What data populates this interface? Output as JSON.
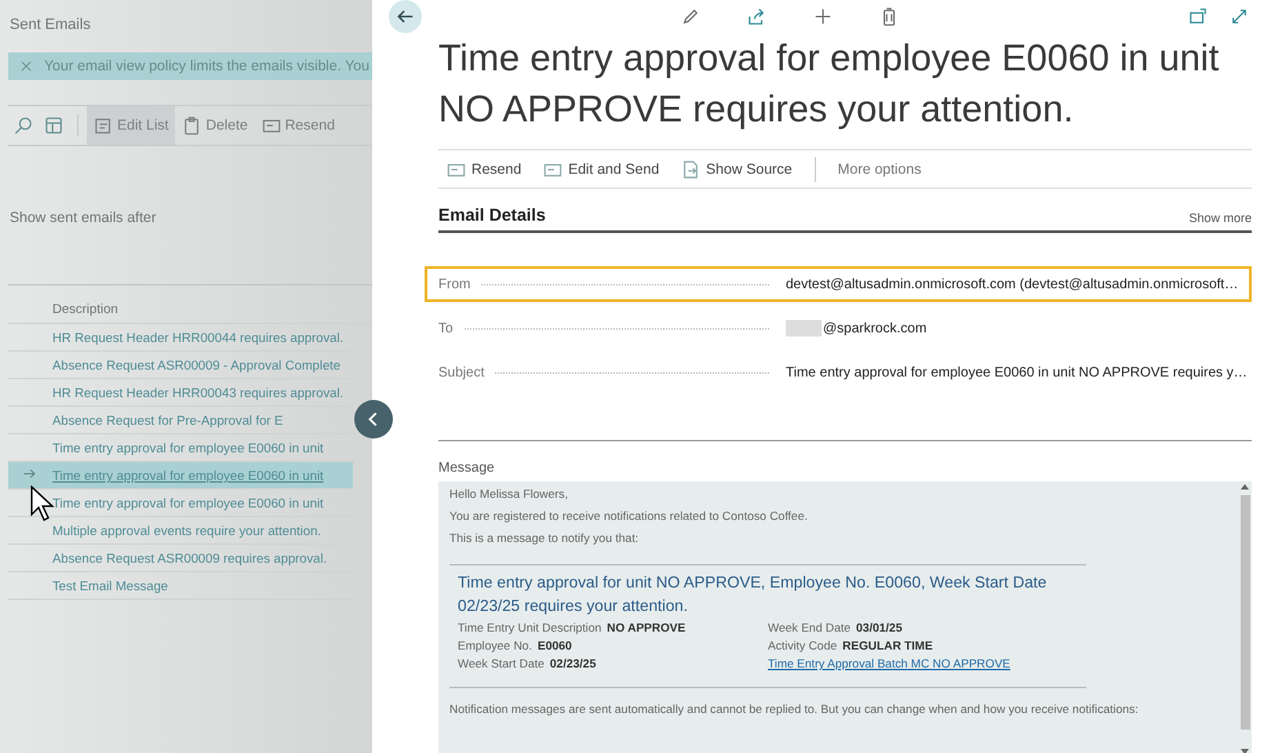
{
  "list_page": {
    "title": "Sent Emails",
    "banner": "Your email view policy limits the emails visible. You",
    "toolbar": [
      {
        "kind": "search"
      },
      {
        "kind": "layout"
      },
      {
        "kind": "edit",
        "label": "Edit List",
        "selected": true
      },
      {
        "kind": "delete",
        "label": "Delete",
        "selected": false
      },
      {
        "kind": "resend",
        "label": "Resend",
        "selected": false
      }
    ],
    "filter_label": "Show sent emails after",
    "column": "Description",
    "rows": [
      {
        "text": "HR Request Header HRR00044 requires approval.",
        "selected": false
      },
      {
        "text": "Absence Request ASR00009 - Approval Complete",
        "selected": false
      },
      {
        "text": "HR Request Header HRR00043 requires approval.",
        "selected": false
      },
      {
        "text": "Absence Request for Pre-Approval for E",
        "selected": false
      },
      {
        "text": "Time entry approval for employee E0060 in unit",
        "selected": false
      },
      {
        "text": "Time entry approval for employee E0060 in unit",
        "selected": true
      },
      {
        "text": "Time entry approval for employee E0060 in unit",
        "selected": false
      },
      {
        "text": "Multiple approval events require your attention.",
        "selected": false
      },
      {
        "text": "Absence Request ASR00009 requires approval.",
        "selected": false
      },
      {
        "text": "Test Email Message",
        "selected": false
      }
    ]
  },
  "card": {
    "title": "Time entry approval for employee E0060 in unit NO APPROVE requires your attention.",
    "actions": [
      {
        "kind": "resend",
        "label": "Resend"
      },
      {
        "kind": "edit",
        "label": "Edit and Send"
      },
      {
        "kind": "source",
        "label": "Show Source"
      },
      {
        "kind": "more",
        "label": "More options"
      }
    ],
    "section": "Email Details",
    "show_more": "Show more",
    "fields": [
      {
        "label": "From",
        "value": "devtest@altusadmin.onmicrosoft.com (devtest@altusadmin.onmicrosoft…",
        "selected": true,
        "kind": "text"
      },
      {
        "label": "To",
        "value": "@sparkrock.com",
        "selected": false,
        "kind": "redacted"
      },
      {
        "label": "Subject",
        "value": "Time entry approval for employee E0060 in unit NO APPROVE requires y…",
        "selected": false,
        "kind": "text"
      }
    ],
    "message_label": "Message",
    "message": {
      "lines": [
        "Hello Melissa Flowers,",
        "You are registered to receive notifications related to Contoso Coffee.",
        "This is a message to notify you that:"
      ],
      "heading": "Time entry approval for unit NO APPROVE, Employee No. E0060, Week Start Date 02/23/25 requires your attention.",
      "details": [
        {
          "label": "Time Entry Unit Description",
          "value": "NO APPROVE"
        },
        {
          "label": "Week End Date",
          "value": "03/01/25"
        },
        {
          "label": "Employee No.",
          "value": "E0060"
        },
        {
          "label": "Activity Code",
          "value": "REGULAR TIME"
        },
        {
          "label": "Week Start Date",
          "value": "02/23/25"
        }
      ],
      "link": "Time Entry Approval Batch MC NO APPROVE",
      "footer": "Notification messages are sent automatically and cannot be replied to. But you can change when and how you receive notifications:"
    }
  }
}
